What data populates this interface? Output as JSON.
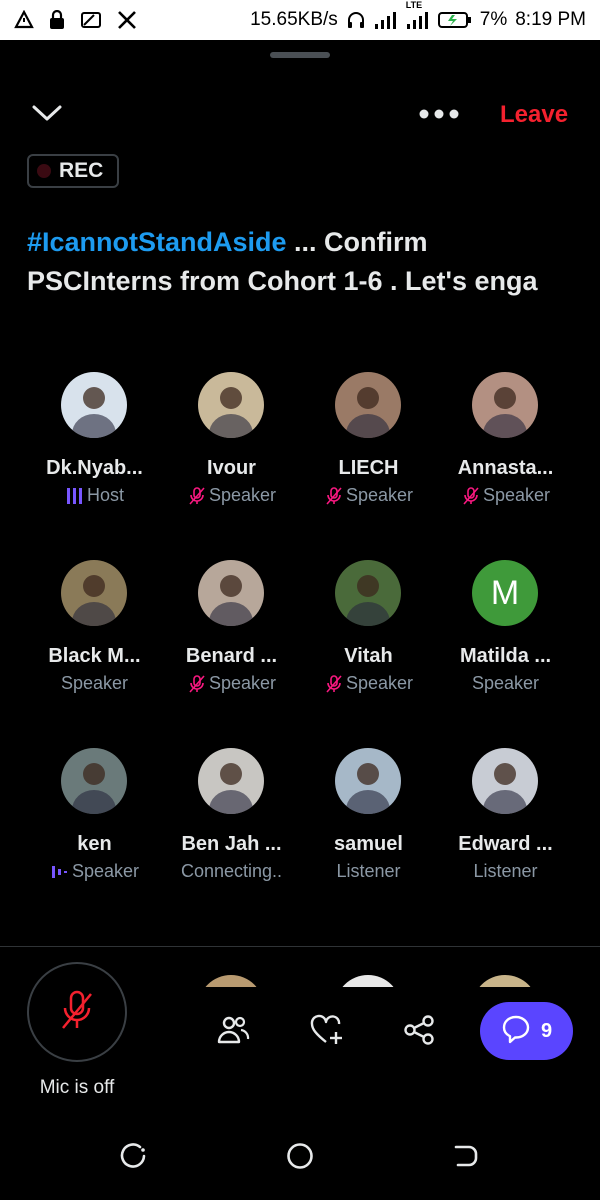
{
  "status_bar": {
    "left_icons": [
      "notification-icon",
      "lock-icon",
      "cast-icon",
      "x-logo-icon"
    ],
    "speed": "15.65KB/s",
    "network_label": "LTE",
    "battery": "7%",
    "time": "8:19 PM"
  },
  "header": {
    "leave_label": "Leave",
    "rec_label": "REC"
  },
  "space": {
    "title_hashtag": "#IcannotStandAside",
    "title_rest": " ... Confirm PSCInterns from Cohort 1-6 . Let's enga"
  },
  "participants": [
    {
      "name": "Dk.Nyab...",
      "role": "Host",
      "indicator": "host-bars-icon",
      "avatar_color": "#d8e2ec"
    },
    {
      "name": "Ivour",
      "role": "Speaker",
      "indicator": "muted-mic-icon",
      "avatar_color": "#c9b99a"
    },
    {
      "name": "LIECH",
      "role": "Speaker",
      "indicator": "muted-mic-icon",
      "avatar_color": "#9a7a66"
    },
    {
      "name": "Annasta...",
      "role": "Speaker",
      "indicator": "muted-mic-icon",
      "avatar_color": "#b39082"
    },
    {
      "name": "Black M...",
      "role": "Speaker",
      "indicator": "",
      "avatar_color": "#8a7a58"
    },
    {
      "name": "Benard ...",
      "role": "Speaker",
      "indicator": "muted-mic-icon",
      "avatar_color": "#b7a79a"
    },
    {
      "name": "Vitah",
      "role": "Speaker",
      "indicator": "muted-mic-icon",
      "avatar_color": "#4a6a3a"
    },
    {
      "name": "Matilda ...",
      "role": "Speaker",
      "indicator": "",
      "avatar_color": "#3f9a3a",
      "initial": "M"
    },
    {
      "name": "ken",
      "role": "Speaker",
      "indicator": "speaking-bars-icon",
      "avatar_color": "#6a7a7a"
    },
    {
      "name": "Ben Jah ...",
      "role": "Connecting..",
      "indicator": "",
      "avatar_color": "#c8c6c2"
    },
    {
      "name": "samuel",
      "role": "Listener",
      "indicator": "",
      "avatar_color": "#a6b8c8"
    },
    {
      "name": "Edward ...",
      "role": "Listener",
      "indicator": "",
      "avatar_color": "#c8ccd4"
    }
  ],
  "controls": {
    "mic_label": "Mic is off",
    "chat_count": "9"
  },
  "colors": {
    "accent_blue": "#1d9bf0",
    "leave_red": "#f4212e",
    "mute_pink": "#f91880",
    "host_purple": "#7856ff",
    "chat_button": "#5a45ff"
  }
}
